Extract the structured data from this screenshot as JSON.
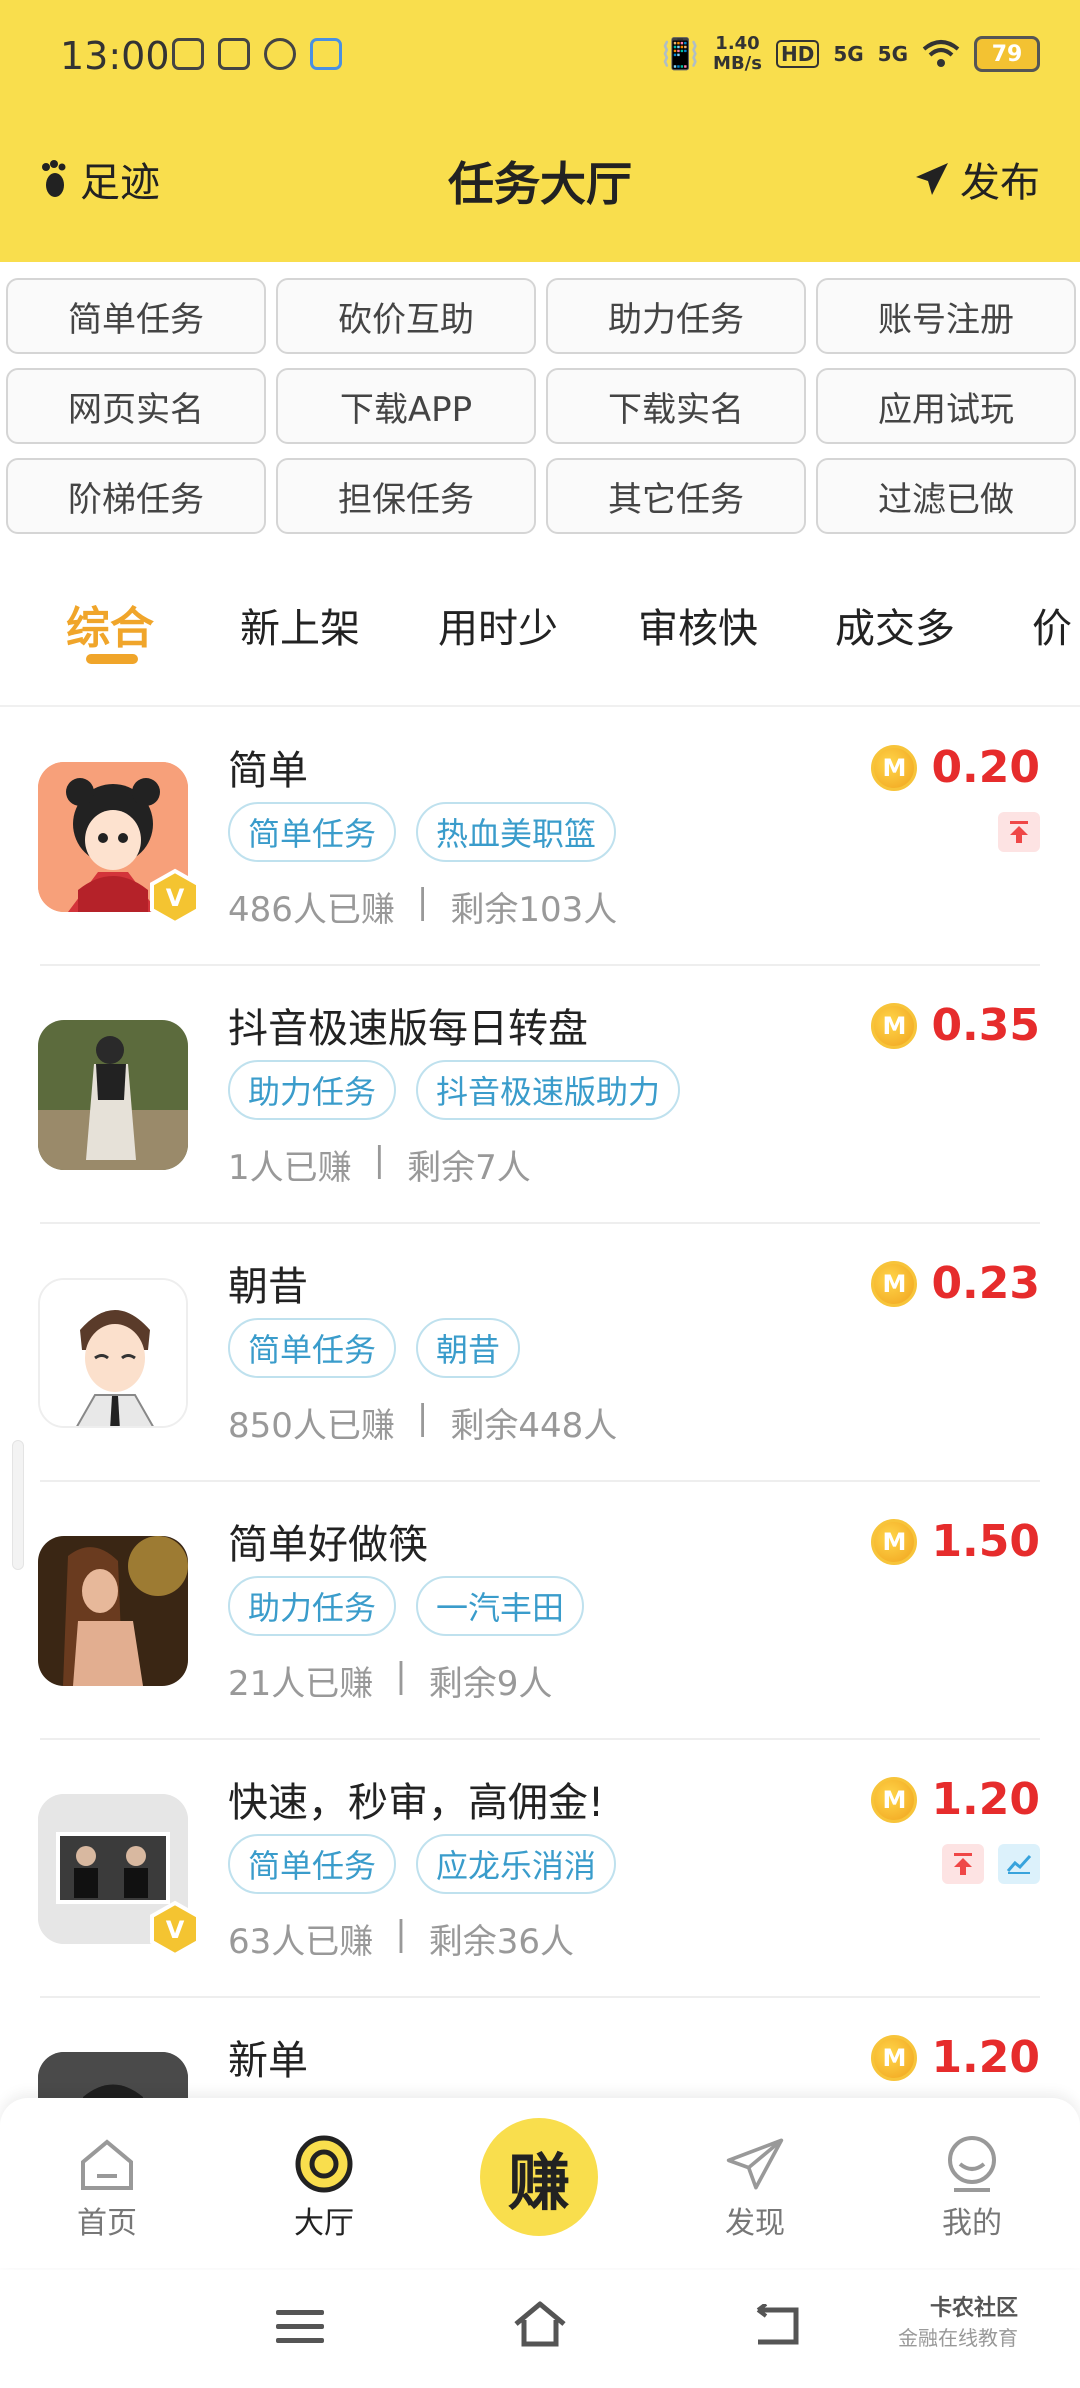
{
  "status_bar": {
    "time": "13:00",
    "speed": "1.40\nMB/s",
    "speed_top": "1.40",
    "speed_bottom": "MB/s",
    "hd": "HD",
    "net1": "5G",
    "net2": "5G",
    "battery": "79"
  },
  "nav": {
    "left_label": "足迹",
    "title": "任务大厅",
    "right_label": "发布"
  },
  "categories": [
    "简单任务",
    "砍价互助",
    "助力任务",
    "账号注册",
    "网页实名",
    "下载APP",
    "下载实名",
    "应用试玩",
    "阶梯任务",
    "担保任务",
    "其它任务",
    "过滤已做"
  ],
  "sorts": [
    "综合",
    "新上架",
    "用时少",
    "审核快",
    "成交多",
    "价"
  ],
  "tasks": [
    {
      "title": "简单",
      "tags": [
        "简单任务",
        "热血美职篮"
      ],
      "earned": "486人已赚",
      "remaining": "剩余103人",
      "price": "0.20",
      "coin": "M",
      "flags": [
        "top"
      ],
      "vip": true
    },
    {
      "title": "抖音极速版每日转盘",
      "tags": [
        "助力任务",
        "抖音极速版助力"
      ],
      "earned": "1人已赚",
      "remaining": "剩余7人",
      "price": "0.35",
      "coin": "M",
      "flags": [],
      "vip": false
    },
    {
      "title": "朝昔",
      "tags": [
        "简单任务",
        "朝昔"
      ],
      "earned": "850人已赚",
      "remaining": "剩余448人",
      "price": "0.23",
      "coin": "M",
      "flags": [],
      "vip": false
    },
    {
      "title": "简单好做筷",
      "tags": [
        "助力任务",
        "一汽丰田"
      ],
      "earned": "21人已赚",
      "remaining": "剩余9人",
      "price": "1.50",
      "coin": "M",
      "flags": [],
      "vip": false
    },
    {
      "title": "快速，秒审，高佣金!",
      "tags": [
        "简单任务",
        "应龙乐消消"
      ],
      "earned": "63人已赚",
      "remaining": "剩余36人",
      "price": "1.20",
      "coin": "M",
      "flags": [
        "top",
        "chart"
      ],
      "vip": true
    },
    {
      "title": "新单",
      "tags": [],
      "earned": "",
      "remaining": "",
      "price": "1.20",
      "coin": "M",
      "flags": [],
      "vip": false
    }
  ],
  "separator": "|",
  "tabbar": {
    "items": [
      {
        "label": "首页",
        "icon": "home-icon"
      },
      {
        "label": "大厅",
        "icon": "hall-icon"
      },
      {
        "label": "发现",
        "icon": "paper-plane-icon"
      },
      {
        "label": "我的",
        "icon": "profile-icon"
      }
    ],
    "center_label": "赚"
  },
  "watermark": {
    "line1": "卡农社区",
    "line2": "金融在线教育"
  },
  "colors": {
    "header": "#f9de4d",
    "accent": "#f0a52a",
    "price": "#e62c2c",
    "tag": "#3a9ccb"
  }
}
